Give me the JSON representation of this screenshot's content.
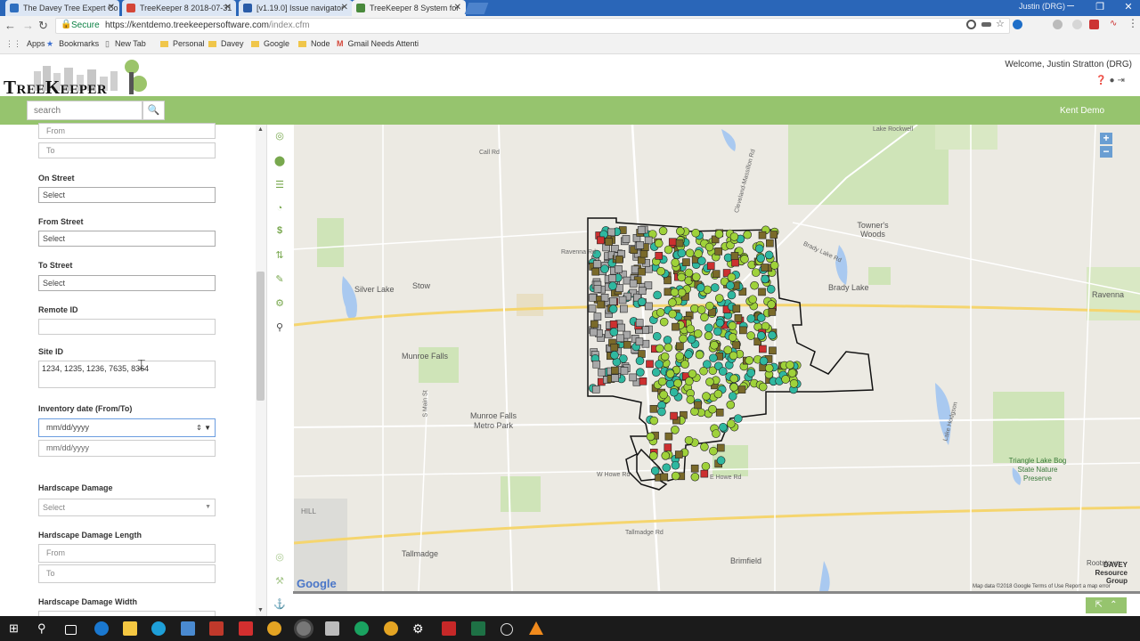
{
  "browser": {
    "tabs": [
      {
        "title": "The Davey Tree Expert Co",
        "color": "#2f6fbf",
        "active": false
      },
      {
        "title": "TreeKeeper 8 2018-07-31",
        "color": "#d44638",
        "active": false
      },
      {
        "title": "[v1.19.0] Issue navigator",
        "color": "#2a5ca8",
        "active": false
      },
      {
        "title": "TreeKeeper 8 System for",
        "color": "#4a8a3c",
        "active": true
      }
    ],
    "user": "Justin (DRG)",
    "secure_label": "Secure",
    "url_host": "https://kentdemo.treekeepersoftware.com",
    "url_path": "/index.cfm",
    "bookmarks": [
      "Apps",
      "Bookmarks",
      "New Tab",
      "Personal",
      "Davey",
      "Google",
      "Node",
      "Gmail Needs Attenti"
    ]
  },
  "app": {
    "logo_text": "TreeKeeper",
    "welcome": "Welcome, Justin Stratton (DRG)",
    "search_placeholder": "search",
    "client_name": "Kent Demo"
  },
  "filters": {
    "range1_from": "From",
    "range1_to": "To",
    "on_street_label": "On Street",
    "on_street_value": "Select",
    "from_street_label": "From Street",
    "from_street_value": "Select",
    "to_street_label": "To Street",
    "to_street_value": "Select",
    "remote_id_label": "Remote ID",
    "remote_id_value": "",
    "site_id_label": "Site ID",
    "site_id_value": "1234, 1235, 1236, 7635, 8364",
    "inventory_date_label": "Inventory date (From/To)",
    "inventory_from": "mm/dd/yyyy",
    "inventory_to": "mm/dd/yyyy",
    "hardscape_damage_label": "Hardscape Damage",
    "hardscape_damage_value": "Select",
    "hardscape_length_label": "Hardscape Damage Length",
    "hardscape_length_from": "From",
    "hardscape_length_to": "To",
    "hardscape_width_label": "Hardscape Damage Width"
  },
  "map": {
    "towns": {
      "silver_lake": "Silver Lake",
      "stow": "Stow",
      "munroe_falls": "Munroe Falls",
      "munroe_park": "Munroe Falls Metro Park",
      "brady_lake": "Brady Lake",
      "ravenna": "Ravenna",
      "towners_woods": "Towner's Woods",
      "tallmadge": "Tallmadge",
      "brimfield": "Brimfield",
      "triangle": "Triangle Lake Bog State Nature Preserve",
      "rootstown": "Rootstown",
      "lake_rockwell": "Lake Rockwell",
      "hill": "HILL"
    },
    "roads": [
      "Cleveland-Massillon Rd",
      "Call Rd",
      "Ravenna Rd",
      "Brady Lake Rd",
      "S Main St",
      "W Howe Rd",
      "E Howe Rd",
      "Tallmadge Rd",
      "Lake Hodgson"
    ],
    "google": "Google",
    "footer": "Map data ©2018 Google   Terms of Use   Report a map error",
    "watermark": "DAVEY Resource Group",
    "tree_status_colors": {
      "good": "#9fd23a",
      "fair": "#2fb8a0",
      "poor": "#7a6a2a",
      "dead": "#cc3030",
      "stump": "#a8a8a8"
    }
  }
}
